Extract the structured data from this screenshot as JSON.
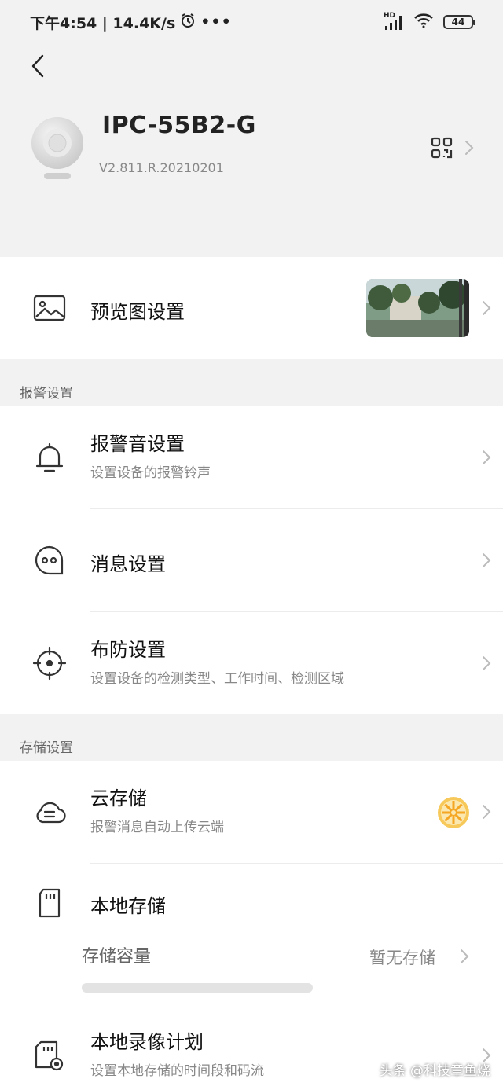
{
  "status_bar": {
    "time_speed": "下午4:54 | 14.4K/s",
    "dots": "•••",
    "hd": "HD",
    "battery": "44"
  },
  "device": {
    "name": "IPC-55B2-G",
    "version": "V2.811.R.20210201"
  },
  "preview": {
    "title": "预览图设置"
  },
  "alarm_section": {
    "label": "报警设置",
    "sound": {
      "title": "报警音设置",
      "subtitle": "设置设备的报警铃声"
    },
    "message": {
      "title": "消息设置"
    },
    "arming": {
      "title": "布防设置",
      "subtitle": "设置设备的检测类型、工作时间、检测区域"
    }
  },
  "storage_section": {
    "label": "存储设置",
    "cloud": {
      "title": "云存储",
      "subtitle": "报警消息自动上传云端"
    },
    "local": {
      "title": "本地存储",
      "capacity_label": "存储容量",
      "capacity_value": "暂无存储"
    },
    "plan": {
      "title": "本地录像计划",
      "subtitle": "设置本地存储的时间段和码流"
    }
  },
  "watermark": "头条 @科技章鱼烧",
  "colors": {
    "background": "#f2f2f2",
    "card": "#ffffff",
    "title": "#111111",
    "subtitle": "#888888",
    "cloud_badge": "#f5a623"
  },
  "icons": [
    "back-arrow-icon",
    "alarm-clock-icon",
    "signal-icon",
    "wifi-icon",
    "battery-icon",
    "qr-code-icon",
    "chevron-right-icon",
    "image-icon",
    "bell-icon",
    "message-bubble-icon",
    "crosshair-icon",
    "cloud-icon",
    "sd-card-icon",
    "sd-card-record-icon",
    "orange-slice-icon"
  ]
}
